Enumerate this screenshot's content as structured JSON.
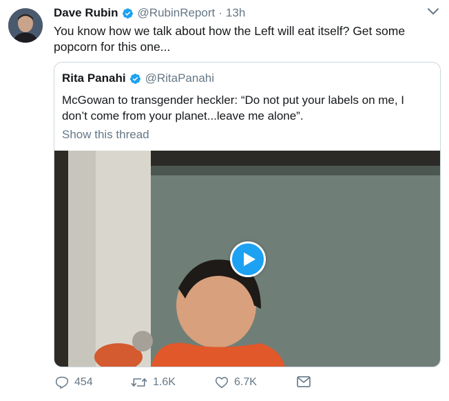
{
  "tweet": {
    "author_name": "Dave Rubin",
    "author_handle": "@RubinReport",
    "separator": "·",
    "time": "13h",
    "text": "You know how we talk about how the Left will eat itself? Get some popcorn for this one...",
    "verified_color": "#1da1f2"
  },
  "quoted_tweet": {
    "author_name": "Rita Panahi",
    "author_handle": "@RitaPanahi",
    "text": "McGowan to transgender heckler: “Do not put your labels on me, I don’t come from your planet...leave me alone”.",
    "show_thread": "Show this thread"
  },
  "actions": {
    "reply_count": "454",
    "retweet_count": "1.6K",
    "like_count": "6.7K"
  },
  "icons": [
    "verified-badge-icon",
    "chevron-down-icon",
    "play-icon",
    "reply-icon",
    "retweet-icon",
    "like-icon",
    "message-icon"
  ],
  "colors": {
    "accent": "#1da1f2",
    "muted": "#657786",
    "text": "#14171a",
    "border": "#ccd6dd"
  }
}
